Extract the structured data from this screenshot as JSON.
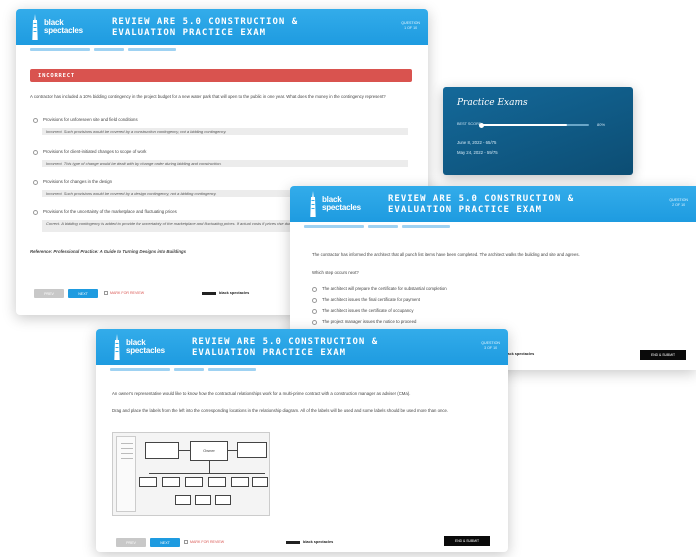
{
  "brand": {
    "line1": "black",
    "line2": "spectacles"
  },
  "exam_title_line1": "REVIEW ARE 5.0 CONSTRUCTION &",
  "exam_title_line2": "EVALUATION PRACTICE EXAM",
  "card1": {
    "qnum_line1": "QUESTION",
    "qnum_line2": "1 OF 10",
    "status_banner": "INCORRECT",
    "question": "A contractor has included a 10% bidding contingency in the project budget for a new water park that will open to the public in one year. What does the money in the contingency represent?",
    "options": [
      {
        "label": "Provisions for unforeseen site and field conditions",
        "explanation": "Incorrect. Such provisions would be covered by a construction contingency, not a bidding contingency."
      },
      {
        "label": "Provisions for client-initiated changes to scope of work",
        "explanation": "Incorrect. This type of change would be dealt with by change order during bidding and construction."
      },
      {
        "label": "Provisions for changes in the design",
        "explanation": "Incorrect. Such provisions would be covered by a design contingency, not a bidding contingency."
      },
      {
        "label": "Provisions for the uncertainty of the marketplace and fluctuating prices",
        "explanation": "Correct. A bidding contingency is added to provide for uncertainty of the marketplace and fluctuating prices. If actual costs if prices rise due to market forces."
      }
    ],
    "reference": "Reference: Professional Practice: A Guide to Turning Designs into Buildings",
    "prev_label": "PREV",
    "next_label": "NEXT",
    "mark_label": "MARK FOR REVIEW"
  },
  "practice_panel": {
    "title": "Practice Exams",
    "best_score_label": "BEST SCORE",
    "best_score_value": "80%",
    "best_score_fraction": 0.8,
    "attempts": [
      "June 8, 2022 - 65/75",
      "May 24, 2022 - 59/75"
    ]
  },
  "card2": {
    "qnum_line1": "QUESTION",
    "qnum_line2": "2 OF 10",
    "question": "The contractor has informed the architect that all punch list items have been completed. The architect walks the building and site and agrees.",
    "prompt": "Which step occurs next?",
    "options": [
      "The architect will prepare the certificate for substantial completion",
      "The architect issues the final certificate for payment",
      "The architect issues the certificate of occupancy",
      "The project manager issues the notice to proceed"
    ],
    "submit_label": "END & SUBMIT"
  },
  "card3": {
    "qnum_line1": "QUESTION",
    "qnum_line2": "3 OF 10",
    "question": "An owner's representative would like to know how the contractual relationships work for a multi-prime contract with a construction manager as adviser (CMa).",
    "instructions": "Drag and place the labels from the left into the corresponding locations in the relationship diagram. All of the labels will be used and some labels should be used more than once.",
    "diagram_center_label": "Owner",
    "prev_label": "PREV",
    "next_label": "NEXT",
    "mark_label": "MARK FOR REVIEW",
    "submit_label": "END & SUBMIT"
  },
  "colors": {
    "header_blue": "#1e9be0",
    "incorrect_red": "#d9534f",
    "panel_navy": "#0f5b85"
  }
}
